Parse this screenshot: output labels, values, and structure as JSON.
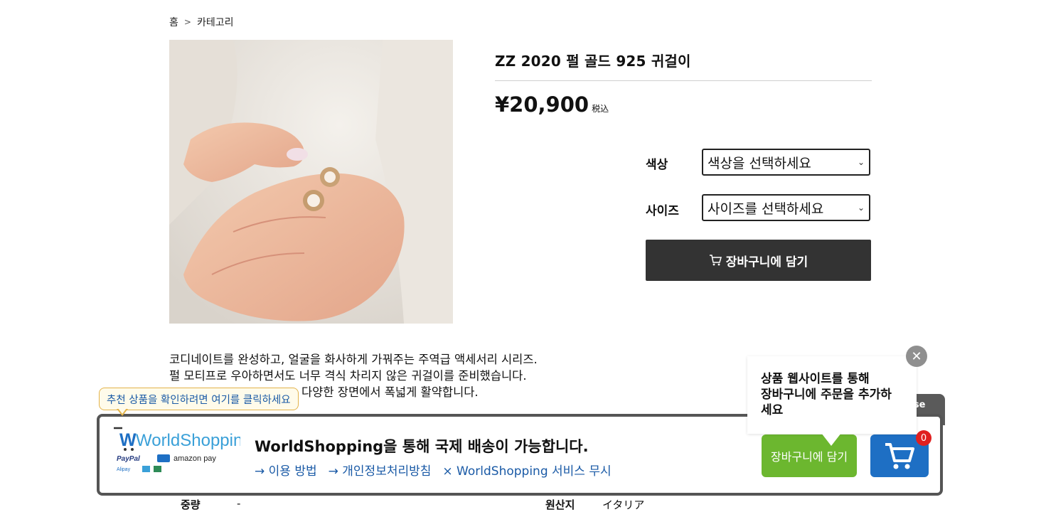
{
  "breadcrumb": {
    "home": "홈",
    "separator": ">",
    "category": "카테고리"
  },
  "product": {
    "title": "ZZ 2020 펄 골드 925 귀걸이",
    "price": "¥20,900",
    "tax_label": "税込",
    "options": [
      {
        "label": "색상",
        "value": "색상을 선택하세요"
      },
      {
        "label": "사이즈",
        "value": "사이즈를 선택하세요"
      }
    ],
    "add_to_cart": "장바구니에 담기",
    "description": [
      "코디네이트를 완성하고, 얼굴을 화사하게 가꿔주는 주역급 액세서리 시리즈.",
      "펄 모티프로 우아하면서도 너무 격식 차리지 않은 귀걸이를 준비했습니다.",
      "다양한 장면에서 폭넓게 활약합니다."
    ],
    "info": [
      {
        "label": "중량",
        "value": "-"
      },
      {
        "label": "원산지",
        "value": "イタリア"
      }
    ]
  },
  "worldshopping": {
    "tooltip": "추천 상품을 확인하려면 여기를 클릭하세요",
    "logo_text": "WorldShopping",
    "payments": [
      "PayPal",
      "amazon pay"
    ],
    "heading": "WorldShopping을 통해 국제 배송이 가능합니다.",
    "links": [
      "→ 이용 방법",
      "→ 개인정보처리방침",
      "× WorldShopping 서비스 무시"
    ],
    "close_tab": "ose",
    "cart_button": "장바구니에 담기",
    "cart_count": "0",
    "popup_lines": [
      "상품 웹사이트를 통해",
      "장바구니에 주문을 추가하",
      "세요"
    ]
  },
  "colors": {
    "accent_dark": "#333333",
    "ws_green": "#6cb72f",
    "ws_blue": "#1e6fc4",
    "link_blue": "#1a5aa6"
  }
}
